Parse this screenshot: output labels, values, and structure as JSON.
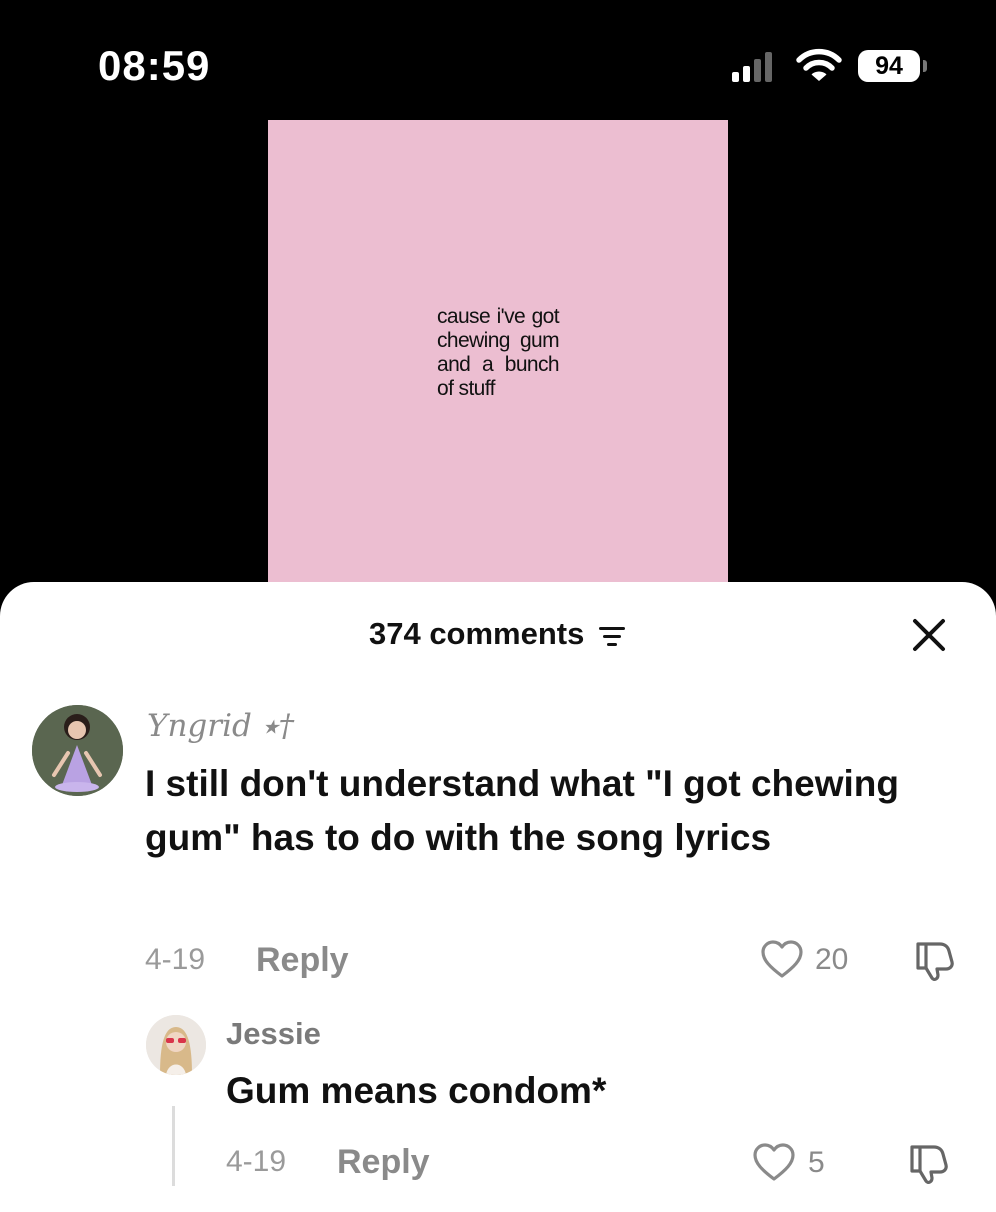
{
  "status_bar": {
    "time": "08:59",
    "battery": "94"
  },
  "video": {
    "caption": "cause i've got chewing gum and a bunch of stuff"
  },
  "comments_panel": {
    "title": "374 comments"
  },
  "comments": [
    {
      "username": "Yngrid ⭑†",
      "text": "I still don't understand what \"I got chewing gum\" has to do with the song lyrics",
      "date": "4-19",
      "reply_label": "Reply",
      "likes": "20"
    },
    {
      "username": "Jessie",
      "text": "Gum means condom*",
      "date": "4-19",
      "reply_label": "Reply",
      "likes": "5"
    }
  ]
}
